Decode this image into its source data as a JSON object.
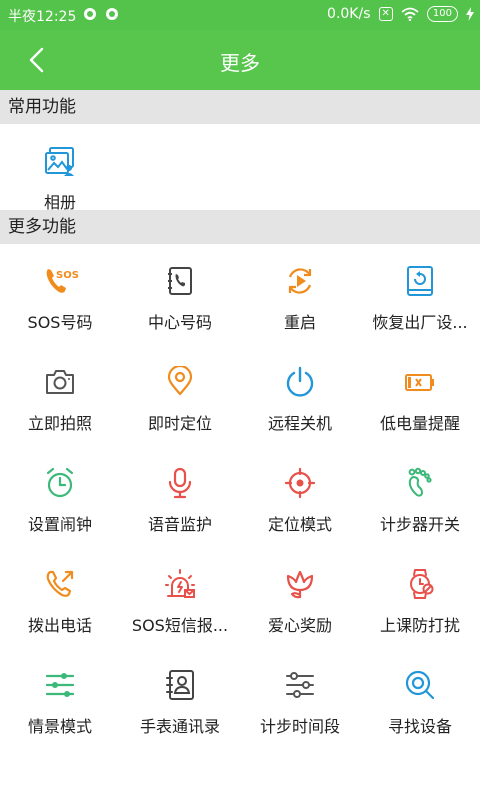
{
  "status_bar": {
    "time": "半夜12:25",
    "network_speed": "0.0K/s",
    "battery": "100"
  },
  "header": {
    "title": "更多"
  },
  "sections": {
    "common_title": "常用功能",
    "more_title": "更多功能"
  },
  "common_items": [
    {
      "label": "相册",
      "icon": "photo-album-icon",
      "color": "#2196d9"
    }
  ],
  "more_items": [
    {
      "label": "SOS号码",
      "icon": "sos-phone-icon",
      "icon_text": "SOS",
      "color": "#f08c1e"
    },
    {
      "label": "中心号码",
      "icon": "center-phone-icon",
      "color": "#444444"
    },
    {
      "label": "重启",
      "icon": "restart-icon",
      "color": "#f08c1e"
    },
    {
      "label": "恢复出厂设...",
      "icon": "factory-reset-icon",
      "color": "#2196d9"
    },
    {
      "label": "立即拍照",
      "icon": "camera-icon",
      "color": "#555555"
    },
    {
      "label": "即时定位",
      "icon": "location-pin-icon",
      "color": "#f08c1e"
    },
    {
      "label": "远程关机",
      "icon": "power-icon",
      "color": "#2196d9"
    },
    {
      "label": "低电量提醒",
      "icon": "low-battery-icon",
      "color": "#f08c1e"
    },
    {
      "label": "设置闹钟",
      "icon": "alarm-clock-icon",
      "color": "#3cb878"
    },
    {
      "label": "语音监护",
      "icon": "microphone-icon",
      "color": "#e8504a"
    },
    {
      "label": "定位模式",
      "icon": "target-icon",
      "color": "#e8504a"
    },
    {
      "label": "计步器开关",
      "icon": "footprint-icon",
      "color": "#3cb878"
    },
    {
      "label": "拨出电话",
      "icon": "outgoing-call-icon",
      "color": "#f08c1e"
    },
    {
      "label": "SOS短信报...",
      "icon": "sos-alarm-icon",
      "color": "#e8504a"
    },
    {
      "label": "爱心奖励",
      "icon": "flower-icon",
      "color": "#e8504a"
    },
    {
      "label": "上课防打扰",
      "icon": "watch-icon",
      "color": "#e8504a"
    },
    {
      "label": "情景模式",
      "icon": "sliders-icon",
      "color": "#3cb878"
    },
    {
      "label": "手表通讯录",
      "icon": "contacts-icon",
      "color": "#444444"
    },
    {
      "label": "计步时间段",
      "icon": "step-time-sliders-icon",
      "color": "#555555"
    },
    {
      "label": "寻找设备",
      "icon": "search-device-icon",
      "color": "#2196d9"
    }
  ]
}
